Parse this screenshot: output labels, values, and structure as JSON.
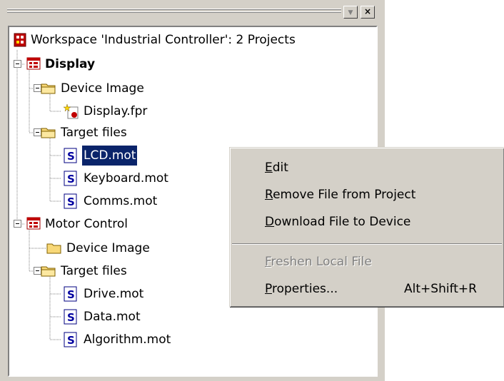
{
  "workspace": {
    "label": "Workspace 'Industrial Controller': 2 Projects",
    "projects": [
      {
        "label": "Display",
        "folders": [
          {
            "label": "Device Image",
            "files": [
              "Display.fpr"
            ]
          },
          {
            "label": "Target files",
            "files": [
              "LCD.mot",
              "Keyboard.mot",
              "Comms.mot"
            ]
          }
        ]
      },
      {
        "label": "Motor Control",
        "folders": [
          {
            "label": "Device Image",
            "files": []
          },
          {
            "label": "Target files",
            "files": [
              "Drive.mot",
              "Data.mot",
              "Algorithm.mot"
            ]
          }
        ]
      }
    ],
    "selected_file": "LCD.mot"
  },
  "panel_buttons": {
    "dropdown": "▼",
    "close": "×"
  },
  "context_menu": {
    "items": [
      {
        "mnemonic": "E",
        "rest": "dit",
        "shortcut": "",
        "enabled": true
      },
      {
        "mnemonic": "R",
        "rest": "emove File from Project",
        "shortcut": "",
        "enabled": true
      },
      {
        "mnemonic": "D",
        "rest": "ownload File to Device",
        "shortcut": "",
        "enabled": true
      },
      {
        "mnemonic": "F",
        "rest": "reshen Local File",
        "shortcut": "",
        "enabled": false
      },
      {
        "mnemonic": "P",
        "rest": "roperties...",
        "shortcut": "Alt+Shift+R",
        "enabled": true
      }
    ]
  },
  "colors": {
    "face": "#d4d0c8",
    "selection": "#0a246a",
    "folder": "#f8d878",
    "project_icon": "#c00000"
  }
}
